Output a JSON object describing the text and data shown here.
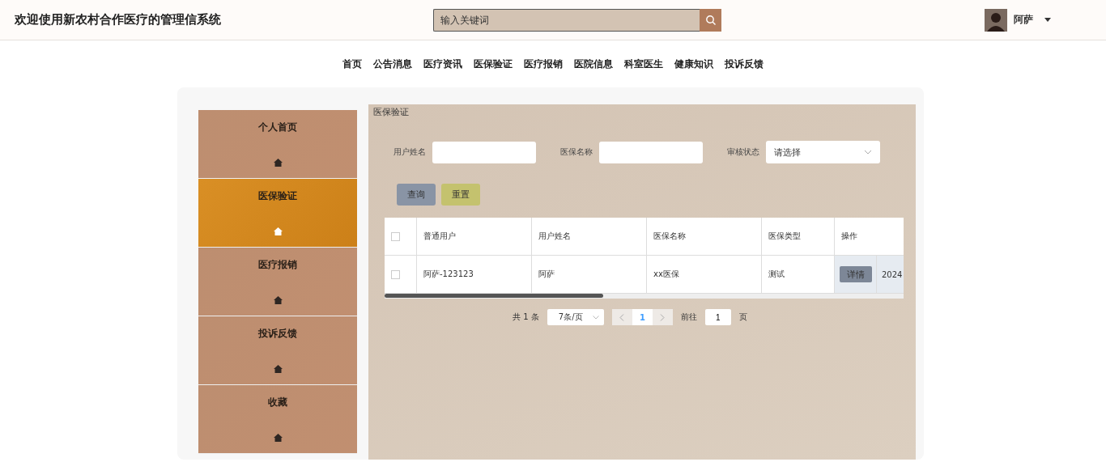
{
  "header": {
    "title": "欢迎使用新农村合作医疗的管理信系统",
    "search": {
      "placeholder": "输入关键词"
    },
    "user": {
      "name": "阿萨"
    }
  },
  "nav": [
    "首页",
    "公告消息",
    "医疗资讯",
    "医保验证",
    "医疗报销",
    "医院信息",
    "科室医生",
    "健康知识",
    "投诉反馈"
  ],
  "sidebar": [
    {
      "label": "个人首页",
      "selected": false
    },
    {
      "label": "医保验证",
      "selected": true
    },
    {
      "label": "医疗报销",
      "selected": false
    },
    {
      "label": "投诉反馈",
      "selected": false
    },
    {
      "label": "收藏",
      "selected": false
    }
  ],
  "panel": {
    "title": "医保验证",
    "filters": [
      {
        "label": "用户姓名",
        "kind": "text"
      },
      {
        "label": "医保名称",
        "kind": "text"
      },
      {
        "label": "审核状态",
        "kind": "select",
        "placeholder": "请选择"
      }
    ],
    "buttons": [
      {
        "label": "查询",
        "kind": "query"
      },
      {
        "label": "重置",
        "kind": "reset"
      }
    ],
    "table": {
      "select_all": false,
      "columns": [
        "普通用户",
        "用户姓名",
        "医保名称",
        "医保类型",
        "操作"
      ],
      "rows": [
        {
          "selected": false,
          "cells": [
            "阿萨-123123",
            "阿萨",
            "xx医保",
            "测试"
          ],
          "action": "详情",
          "column_6": "2024"
        }
      ]
    },
    "pagination": {
      "total": "共 1 条",
      "page_size": "7条/页",
      "pages": [
        {
          "label": "1",
          "selected": true
        }
      ],
      "goto_label": "前往",
      "goto_value": "1",
      "goto_suffix": "页"
    }
  }
}
